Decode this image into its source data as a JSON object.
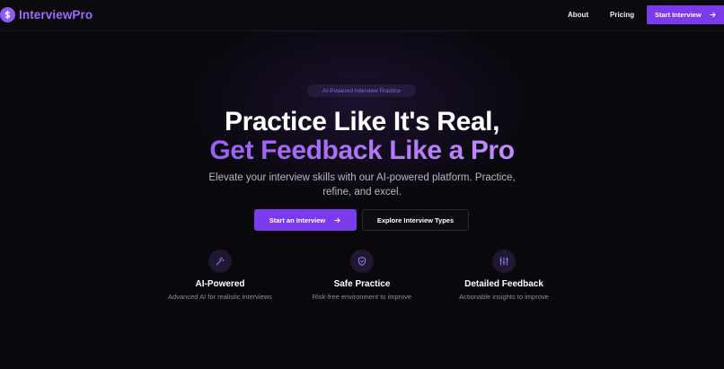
{
  "header": {
    "logo_text": "InterviewPro",
    "logo_icon": "dollar-icon",
    "nav": [
      {
        "label": "About"
      },
      {
        "label": "Pricing"
      }
    ],
    "cta_label": "Start Interview"
  },
  "hero": {
    "badge": "AI-Powered Interview Practice",
    "title_line1": "Practice Like It's Real,",
    "title_line2": "Get Feedback Like a Pro",
    "subtitle": "Elevate your interview skills with our AI-powered platform. Practice, refine, and excel.",
    "primary_button": "Start an Interview",
    "secondary_button": "Explore Interview Types"
  },
  "features": [
    {
      "icon": "wand-icon",
      "title": "AI-Powered",
      "description": "Advanced AI for realistic interviews"
    },
    {
      "icon": "shield-icon",
      "title": "Safe Practice",
      "description": "Risk-free environment to improve"
    },
    {
      "icon": "sliders-icon",
      "title": "Detailed Feedback",
      "description": "Actionable insights to improve"
    }
  ],
  "colors": {
    "accent": "#7c3aed",
    "accent_text": "#a164f6",
    "background": "#09080c"
  }
}
